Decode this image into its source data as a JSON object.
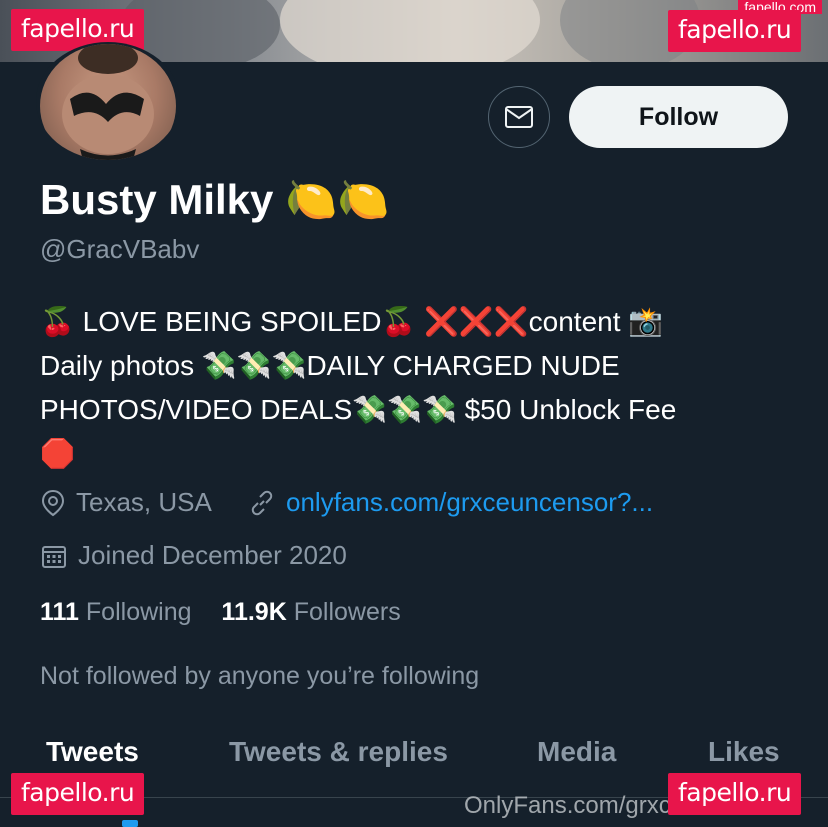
{
  "watermarks": {
    "site": "fapello.ru",
    "site_top_right_small": "fapello.com",
    "onlyfans": "OnlyFans.com/grxceuncensor"
  },
  "profile": {
    "display_name": "Busty Milky 🍋🍋",
    "handle": "@GracVBabv",
    "bio_lines": [
      "🍒 LOVE BEING SPOILED🍒 ❌❌❌content 📸",
      "Daily photos 💸💸💸DAILY CHARGED NUDE",
      "PHOTOS/VIDEO DEALS💸💸💸 $50 Unblock Fee",
      "🛑"
    ],
    "location": "Texas, USA",
    "website": "onlyfans.com/grxceuncensor?...",
    "joined": "Joined December 2020",
    "following_count": "111",
    "following_label": "Following",
    "followers_count": "11.9K",
    "followers_label": "Followers",
    "not_followed_text": "Not followed by anyone you’re following"
  },
  "actions": {
    "follow_label": "Follow",
    "message_icon": "mail-icon"
  },
  "tabs": [
    "Tweets",
    "Tweets & replies",
    "Media",
    "Likes"
  ],
  "active_tab": "Tweets",
  "colors": {
    "background": "#15202b",
    "accent": "#1d9bf0",
    "muted_text": "#8b98a5",
    "watermark": "#e8154b"
  }
}
